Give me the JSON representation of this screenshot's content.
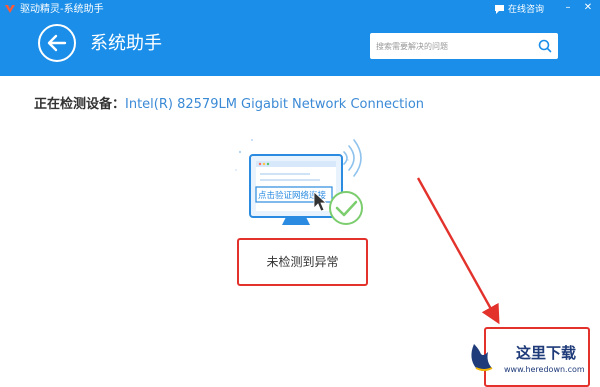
{
  "window": {
    "title": "驱动精灵-系统助手",
    "consult_label": "在线咨询",
    "controls": [
      "–",
      "✕"
    ]
  },
  "header": {
    "page_title": "系统助手",
    "back_icon": "back-arrow-icon",
    "background": "#1a8ee8"
  },
  "search": {
    "placeholder": "搜索需要解决的问题",
    "value": "",
    "icon": "search-icon"
  },
  "detection": {
    "label": "正在检测设备：",
    "device": "Intel(R) 82579LM Gigabit Network Connection",
    "device_color": "#3b8ad6"
  },
  "illustration": {
    "button_label": "点击验证网络连接",
    "icons": [
      "monitor-icon",
      "wifi-signal-icon",
      "cursor-icon",
      "check-circle-icon"
    ]
  },
  "result": {
    "text": "未检测到异常",
    "border_color": "#e3322c"
  },
  "watermark": {
    "cn": "这里下载",
    "en": "www.heredown.com"
  }
}
